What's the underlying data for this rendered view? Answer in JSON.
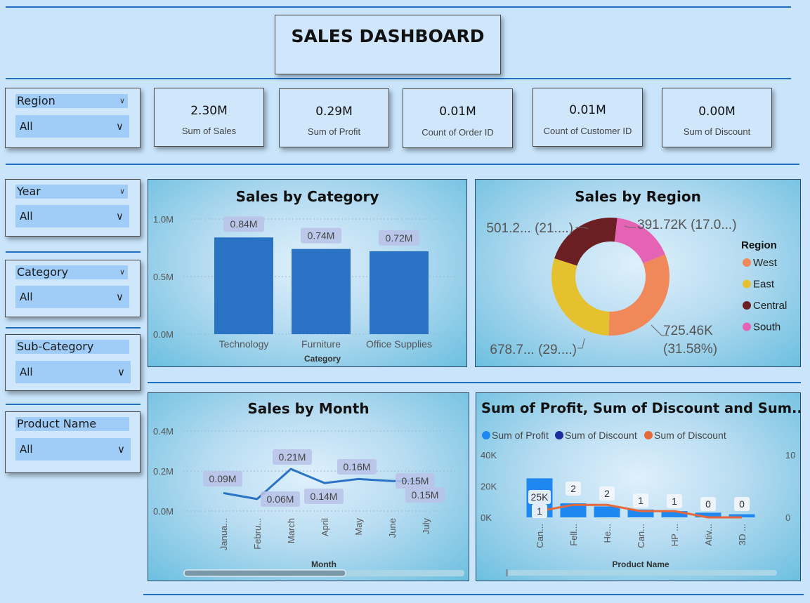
{
  "header": {
    "title": "SALES DASHBOARD"
  },
  "filters": [
    {
      "label": "Region",
      "value": "All"
    },
    {
      "label": "Year",
      "value": "All"
    },
    {
      "label": "Category",
      "value": "All"
    },
    {
      "label": "Sub-Category",
      "value": "All"
    },
    {
      "label": "Product Name",
      "value": "All"
    }
  ],
  "kpis": [
    {
      "value": "2.30M",
      "label": "Sum of Sales"
    },
    {
      "value": "0.29M",
      "label": "Sum of Profit"
    },
    {
      "value": "0.01M",
      "label": "Count of Order ID"
    },
    {
      "value": "0.01M",
      "label": "Count of Customer ID"
    },
    {
      "value": "0.00M",
      "label": "Sum of Discount"
    }
  ],
  "icons": {
    "dropdown": "chevron-down-icon"
  },
  "colors": {
    "bar": "#2a72c4",
    "west": "#f0885a",
    "east": "#e5c130",
    "central": "#6b1f23",
    "south": "#e563b4",
    "profit": "#1e88f0",
    "discount_dark": "#1a2f9c",
    "discount_line": "#e3683a",
    "label_bg": "#b9c2e8"
  },
  "chart_data": [
    {
      "type": "bar",
      "title": "Sales by Category",
      "xlabel": "Category",
      "ylabel": "",
      "categories": [
        "Technology",
        "Furniture",
        "Office Supplies"
      ],
      "values": [
        0.84,
        0.74,
        0.72
      ],
      "data_labels": [
        "0.84M",
        "0.74M",
        "0.72M"
      ],
      "y_ticks": [
        "0.0M",
        "0.5M",
        "1.0M"
      ],
      "ylim": [
        0,
        1.0
      ],
      "grid": true
    },
    {
      "type": "pie",
      "title": "Sales by Region",
      "legend_title": "Region",
      "legend_position": "right",
      "categories": [
        "West",
        "East",
        "Central",
        "South"
      ],
      "values": [
        725.46,
        678.7,
        501.2,
        391.72
      ],
      "percents": [
        31.58,
        29.5,
        21.8,
        17.0
      ],
      "data_labels": [
        "725.46K (31.58%)",
        "678.7... (29....)",
        "501.2... (21....)",
        "391.72K (17.0...)"
      ]
    },
    {
      "type": "line",
      "title": "Sales by Month",
      "xlabel": "Month",
      "ylabel": "",
      "categories": [
        "Janua...",
        "Febru...",
        "March",
        "April",
        "May",
        "June",
        "July"
      ],
      "values": [
        0.09,
        0.06,
        0.21,
        0.14,
        0.16,
        0.15,
        0.15
      ],
      "data_labels": [
        "0.09M",
        "0.06M",
        "0.21M",
        "0.14M",
        "0.16M",
        "0.15M",
        "0.15M"
      ],
      "y_ticks": [
        "0.0M",
        "0.2M",
        "0.4M"
      ],
      "ylim": [
        0,
        0.4
      ],
      "grid": true
    },
    {
      "type": "bar",
      "title": "Sum of Profit, Sum of Discount and Sum...",
      "xlabel": "Product Name",
      "categories": [
        "Can...",
        "Fell...",
        "He...",
        "Can...",
        "HP ...",
        "Ativ...",
        "3D ..."
      ],
      "series": [
        {
          "name": "Sum of Profit",
          "values": [
            25,
            9,
            7,
            5,
            4,
            3,
            2
          ]
        },
        {
          "name": "Sum of Discount",
          "values": [
            1,
            2,
            2,
            1,
            1,
            0,
            0
          ]
        },
        {
          "name": "Sum of Discount",
          "values": [
            1,
            2,
            2,
            1,
            1,
            0,
            0
          ]
        }
      ],
      "legend_position": "top-left",
      "profit_data_labels": [
        "25K"
      ],
      "discount_data_labels": [
        "1",
        "2",
        "2",
        "1",
        "1",
        "0",
        "0"
      ],
      "y_ticks_left": [
        "0K",
        "20K",
        "40K"
      ],
      "ylim_left": [
        0,
        40
      ],
      "y_ticks_right": [
        "0",
        "10"
      ],
      "ylim_right": [
        0,
        10
      ]
    }
  ]
}
